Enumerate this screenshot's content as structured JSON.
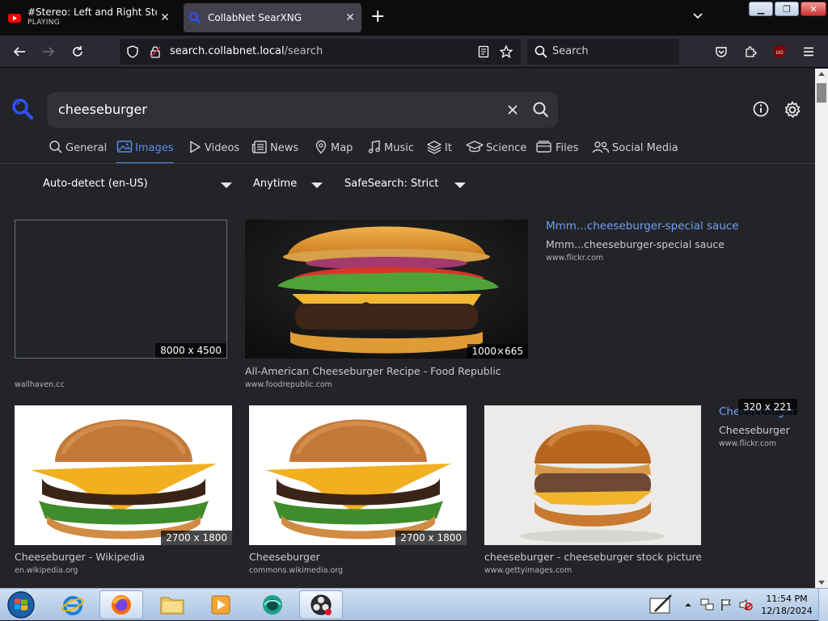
{
  "browser": {
    "tabs": [
      {
        "title": "#Stereo: Left and Right Stereo S",
        "subtitle": "PLAYING",
        "active": false
      },
      {
        "title": "CollabNet SearXNG",
        "active": true
      }
    ],
    "new_tab_label": "+",
    "url_host": "search.collabnet.local",
    "url_path": "/search",
    "search_placeholder": "Search",
    "extension_badge": "UO"
  },
  "search": {
    "query": "cheeseburger"
  },
  "categories": [
    {
      "label": "General",
      "icon": "search-icon"
    },
    {
      "label": "Images",
      "icon": "image-icon",
      "active": true
    },
    {
      "label": "Videos",
      "icon": "play-icon"
    },
    {
      "label": "News",
      "icon": "newspaper-icon"
    },
    {
      "label": "Map",
      "icon": "map-pin-icon"
    },
    {
      "label": "Music",
      "icon": "music-icon"
    },
    {
      "label": "It",
      "icon": "layers-icon"
    },
    {
      "label": "Science",
      "icon": "science-icon"
    },
    {
      "label": "Files",
      "icon": "files-icon"
    },
    {
      "label": "Social Media",
      "icon": "people-icon"
    }
  ],
  "filters": {
    "language": "Auto-detect (en-US)",
    "time": "Anytime",
    "safesearch": "SafeSearch: Strict"
  },
  "results": [
    {
      "title": "",
      "url": "wallhaven.cc",
      "dims": "8000 x 4500"
    },
    {
      "title": "All-American Cheeseburger Recipe - Food Republic",
      "url": "www.foodrepublic.com",
      "dims": "1000×665"
    },
    {
      "title": "Mmm...cheeseburger-special sauce",
      "desc": "Mmm...cheeseburger-special sauce",
      "url": "www.flickr.com"
    },
    {
      "title": "Cheeseburger - Wikipedia",
      "url": "en.wikipedia.org",
      "dims": "2700 x 1800"
    },
    {
      "title": "Cheeseburger",
      "url": "commons.wikimedia.org",
      "dims": "2700 x 1800"
    },
    {
      "title": "cheeseburger - cheeseburger stock pictures...",
      "url": "www.gettyimages.com"
    },
    {
      "title": "Cheeseburger",
      "desc": "Cheeseburger",
      "url": "www.flickr.com",
      "dims": "320 x 221"
    }
  ],
  "taskbar": {
    "time": "11:54 PM",
    "date": "12/18/2024"
  }
}
